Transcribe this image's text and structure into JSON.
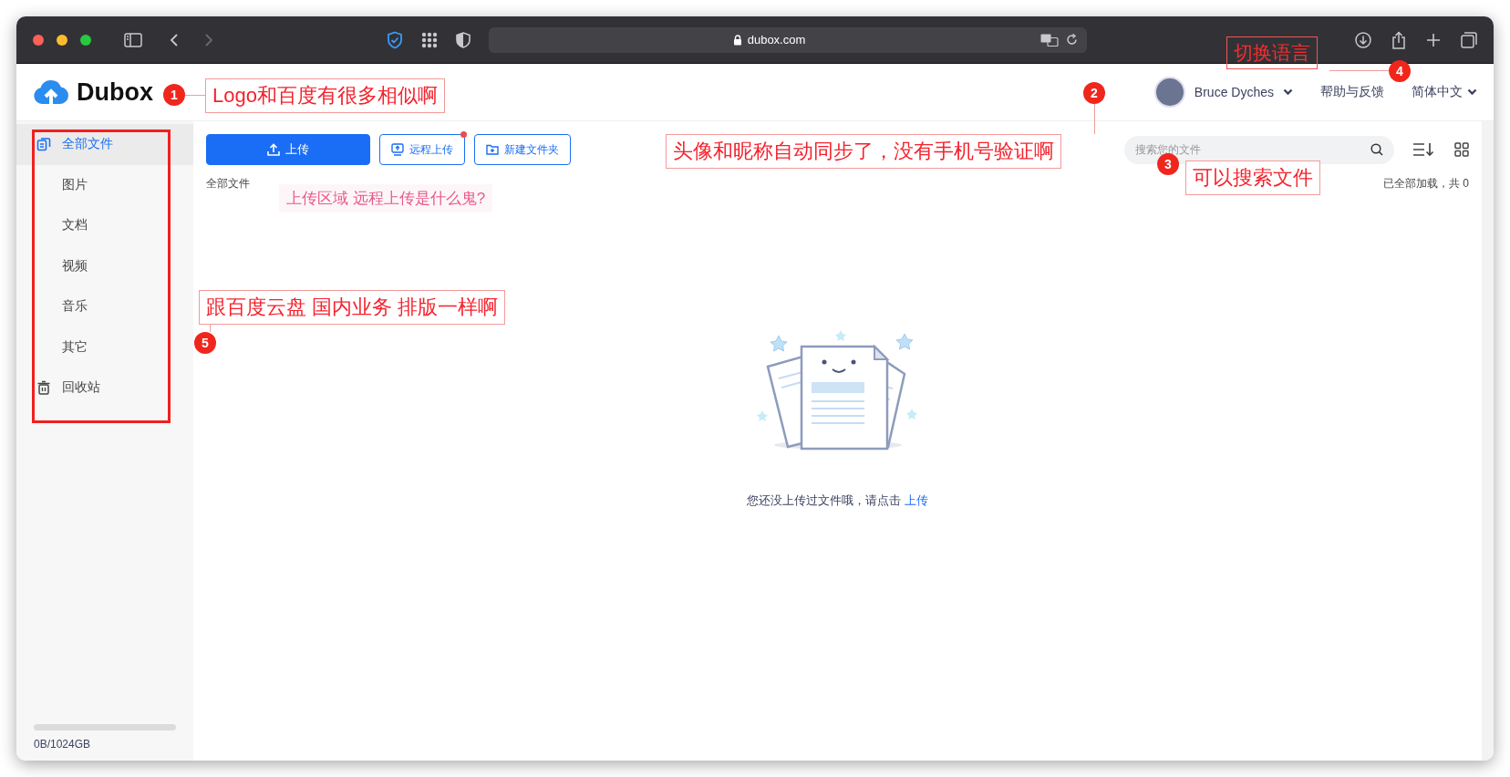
{
  "browser": {
    "url": "dubox.com"
  },
  "header": {
    "logo": "Dubox",
    "user": {
      "name": "Bruce Dyches"
    },
    "help": "帮助与反馈",
    "language": "简体中文"
  },
  "sidebar": {
    "items": [
      {
        "label": "全部文件",
        "selected": true,
        "kind": "all"
      },
      {
        "label": "图片",
        "selected": false,
        "kind": "category"
      },
      {
        "label": "文档",
        "selected": false,
        "kind": "category"
      },
      {
        "label": "视频",
        "selected": false,
        "kind": "category"
      },
      {
        "label": "音乐",
        "selected": false,
        "kind": "category"
      },
      {
        "label": "其它",
        "selected": false,
        "kind": "category"
      },
      {
        "label": "回收站",
        "selected": false,
        "kind": "trash"
      }
    ],
    "storage": {
      "text": "0B/1024GB",
      "level": 0
    }
  },
  "toolbar": {
    "buttons": [
      {
        "label": "上传",
        "kind": "primary",
        "dot": false
      },
      {
        "label": "远程上传",
        "kind": "remote",
        "dot": true
      },
      {
        "label": "新建文件夹",
        "kind": "folder",
        "dot": false
      }
    ],
    "search": {
      "placeholder": "搜索您的文件"
    }
  },
  "breadcrumb": "全部文件",
  "load_status": "已全部加载，共 0",
  "empty": {
    "message": "您还没上传过文件哦，请点击",
    "link": "上传"
  },
  "annotations": [
    {
      "number": "4",
      "text": "切换语言"
    },
    {
      "number": "1",
      "text": "Logo和百度有很多相似啊"
    },
    {
      "number": "2",
      "text": "头像和昵称自动同步了，没有手机号验证啊"
    },
    {
      "number": "3",
      "text": "可以搜索文件"
    },
    {
      "number": "5",
      "text": "跟百度云盘 国内业务 排版一样啊"
    }
  ],
  "note": "上传区域 远程上传是什么鬼?"
}
